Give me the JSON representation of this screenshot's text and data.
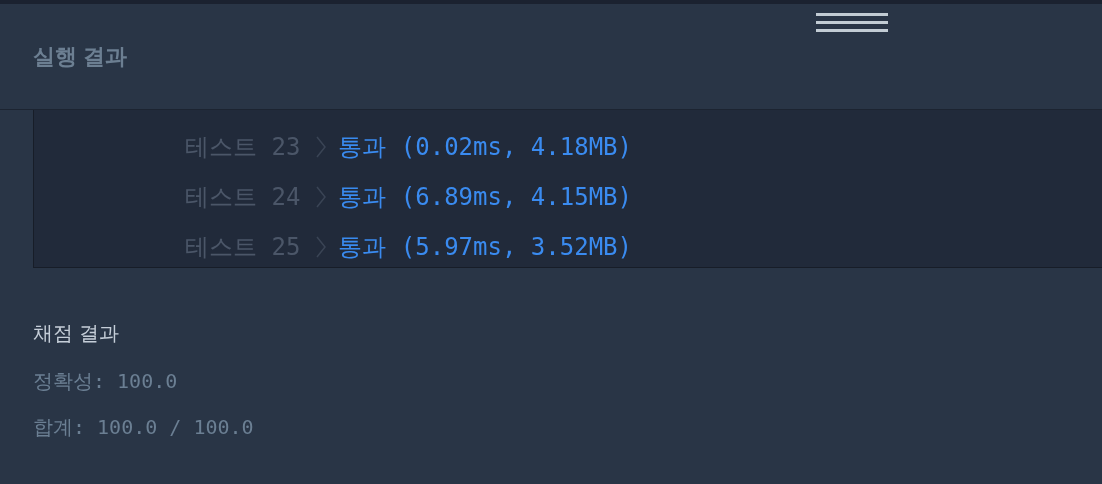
{
  "panel": {
    "title": "실행 결과"
  },
  "tests": [
    {
      "label": "테스트 23",
      "result": "통과 (0.02ms, 4.18MB)"
    },
    {
      "label": "테스트 24",
      "result": "통과 (6.89ms, 4.15MB)"
    },
    {
      "label": "테스트 25",
      "result": "통과 (5.97ms, 3.52MB)"
    }
  ],
  "grading": {
    "title": "채점 결과",
    "lines": [
      "정확성: 100.0",
      "합계: 100.0 / 100.0"
    ]
  }
}
